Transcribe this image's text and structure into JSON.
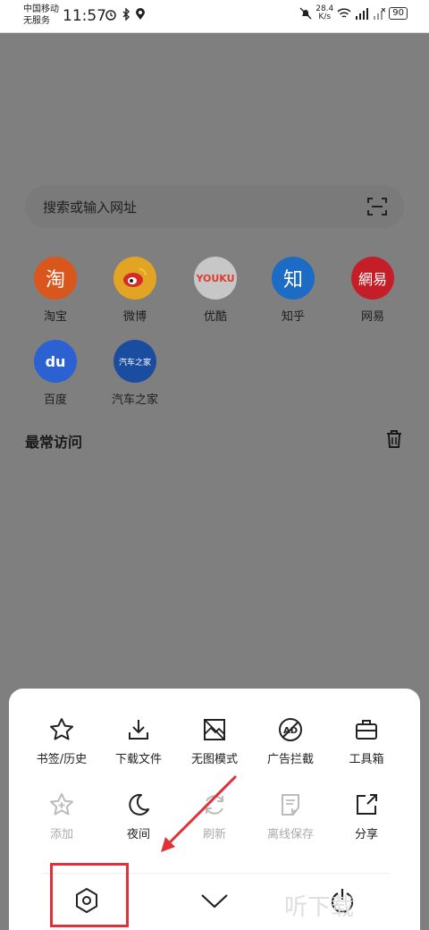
{
  "status": {
    "carrier_line1": "中国移动",
    "carrier_line2": "无服务",
    "time": "11:57",
    "net_speed_value": "28.4",
    "net_speed_unit": "K/s",
    "battery": "90"
  },
  "search": {
    "placeholder": "搜索或输入网址"
  },
  "sites": [
    {
      "label": "淘宝",
      "glyph": "淘",
      "color": "#e0571e"
    },
    {
      "label": "微博",
      "glyph": "◉",
      "color": "#e9a825"
    },
    {
      "label": "优酷",
      "glyph": "YOUKU",
      "color": "#c9c9c9"
    },
    {
      "label": "知乎",
      "glyph": "知",
      "color": "#1e6fcc"
    },
    {
      "label": "网易",
      "glyph": "網易",
      "color": "#c8202a"
    },
    {
      "label": "百度",
      "glyph": "du",
      "color": "#2d64d8"
    },
    {
      "label": "汽车之家",
      "glyph": "汽车之家",
      "color": "#1b4fa8"
    }
  ],
  "frequent": {
    "title": "最常访问"
  },
  "menu": {
    "row1": [
      {
        "label": "书签/历史",
        "icon": "star-icon"
      },
      {
        "label": "下载文件",
        "icon": "download-icon"
      },
      {
        "label": "无图模式",
        "icon": "no-image-icon"
      },
      {
        "label": "广告拦截",
        "icon": "ad-block-icon"
      },
      {
        "label": "工具箱",
        "icon": "toolbox-icon"
      }
    ],
    "row2": [
      {
        "label": "添加",
        "icon": "add-star-icon",
        "disabled": true
      },
      {
        "label": "夜间",
        "icon": "moon-icon",
        "disabled": false
      },
      {
        "label": "刷新",
        "icon": "refresh-icon",
        "disabled": true
      },
      {
        "label": "离线保存",
        "icon": "offline-save-icon",
        "disabled": true
      },
      {
        "label": "分享",
        "icon": "share-icon",
        "disabled": false
      }
    ]
  },
  "watermark": "听下载",
  "colors": {
    "highlight": "#e0303a",
    "disabled": "#aaaaaa"
  }
}
